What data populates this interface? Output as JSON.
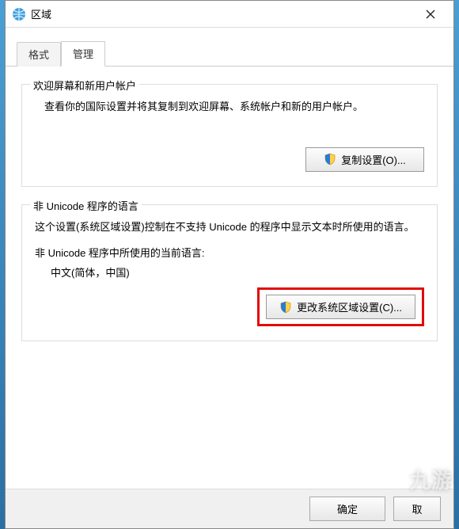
{
  "window": {
    "title": "区域"
  },
  "tabs": {
    "format": "格式",
    "admin": "管理"
  },
  "group1": {
    "legend": "欢迎屏幕和新用户帐户",
    "desc": "查看你的国际设置并将其复制到欢迎屏幕、系统帐户和新的用户帐户。",
    "copy_button": "复制设置(O)..."
  },
  "group2": {
    "legend": "非 Unicode 程序的语言",
    "desc": "这个设置(系统区域设置)控制在不支持 Unicode 的程序中显示文本时所使用的语言。",
    "current_label": "非 Unicode 程序中所使用的当前语言:",
    "current_value": "中文(简体，中国)",
    "change_button": "更改系统区域设置(C)..."
  },
  "footer": {
    "ok": "确定",
    "cancel": "取"
  },
  "watermark": "九游"
}
